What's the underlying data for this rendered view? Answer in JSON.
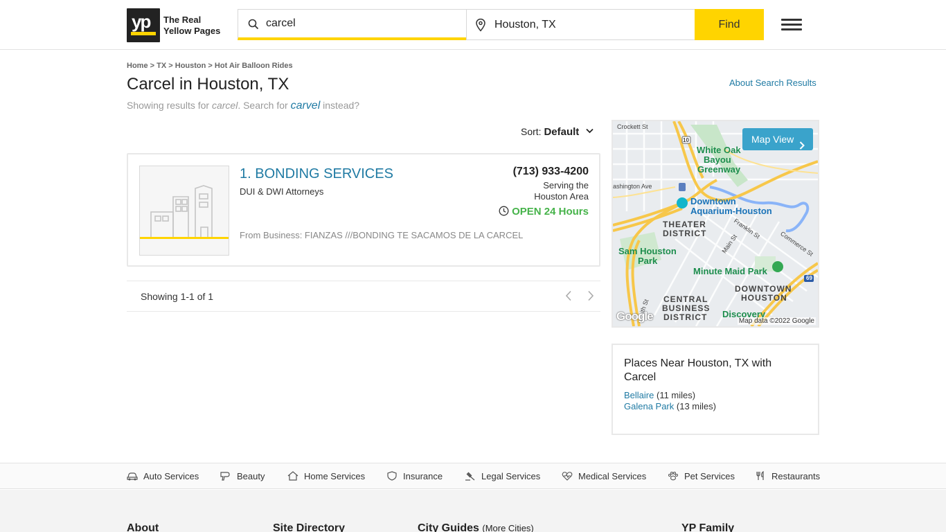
{
  "header": {
    "logo_mark": "yp",
    "logo_text_line1": "The Real",
    "logo_text_line2": "Yellow Pages",
    "search_value": "carcel",
    "location_value": "Houston, TX",
    "find_label": "Find"
  },
  "breadcrumb": {
    "items": [
      "Home",
      "TX",
      "Houston",
      "Hot Air Balloon Rides"
    ],
    "separator": ">"
  },
  "page": {
    "title": "Carcel in Houston, TX",
    "about_link": "About Search Results",
    "showing_prefix": "Showing results for",
    "showing_term": "carcel",
    "search_for": ". Search for",
    "suggestion": "carvel",
    "instead": "instead?"
  },
  "sort": {
    "label": "Sort:",
    "value": "Default"
  },
  "result": {
    "name": "1. BONDING SERVICES",
    "category": "DUI & DWI Attorneys",
    "phone": "(713) 933-4200",
    "serving_line1": "Serving the",
    "serving_line2": "Houston Area",
    "open_status": "OPEN 24 Hours",
    "snippet": "From Business: FIANZAS ///BONDING TE SACAMOS DE LA CARCEL"
  },
  "pager": {
    "count_text": "Showing 1-1 of 1"
  },
  "map": {
    "button_label": "Map View",
    "labels": {
      "crockett": "Crockett St",
      "white_oak_1": "White Oak",
      "white_oak_2": "Bayou",
      "white_oak_3": "Greenway",
      "washington": "ashington Ave",
      "aquarium_1": "Downtown",
      "aquarium_2": "Aquarium-Houston",
      "theater_1": "THEATER",
      "theater_2": "DISTRICT",
      "franklin": "Franklin St",
      "commerce": "Commerce St",
      "main": "Main St",
      "sam_houston_1": "Sam Houston",
      "sam_houston_2": "Park",
      "minute_maid": "Minute Maid Park",
      "downtown_1": "DOWNTOWN",
      "downtown_2": "HOUSTON",
      "cbd_1": "CENTRAL",
      "cbd_2": "BUSINESS",
      "cbd_3": "DISTRICT",
      "discovery": "Discovery",
      "i10": "10",
      "i69": "69",
      "st_frag": "ith St"
    },
    "google": "Google",
    "copyright": "Map data ©2022 Google"
  },
  "places_near": {
    "title": "Places Near Houston, TX with Carcel",
    "items": [
      {
        "name": "Bellaire",
        "distance": "(11 miles)"
      },
      {
        "name": "Galena Park",
        "distance": "(13 miles)"
      }
    ]
  },
  "categories": [
    {
      "label": "Auto Services",
      "icon": "car-icon"
    },
    {
      "label": "Beauty",
      "icon": "hair-dryer-icon"
    },
    {
      "label": "Home Services",
      "icon": "home-icon"
    },
    {
      "label": "Insurance",
      "icon": "shield-icon"
    },
    {
      "label": "Legal Services",
      "icon": "gavel-icon"
    },
    {
      "label": "Medical Services",
      "icon": "heart-pulse-icon"
    },
    {
      "label": "Pet Services",
      "icon": "paw-icon"
    },
    {
      "label": "Restaurants",
      "icon": "utensils-icon"
    }
  ],
  "footer": {
    "about": "About",
    "site_directory": "Site Directory",
    "city_guides": "City Guides",
    "city_guides_more": "(More Cities)",
    "yp_family": "YP Family"
  },
  "colors": {
    "brand_yellow": "#ffd400",
    "link_blue": "#1f7aa3",
    "open_green": "#46b34a"
  }
}
